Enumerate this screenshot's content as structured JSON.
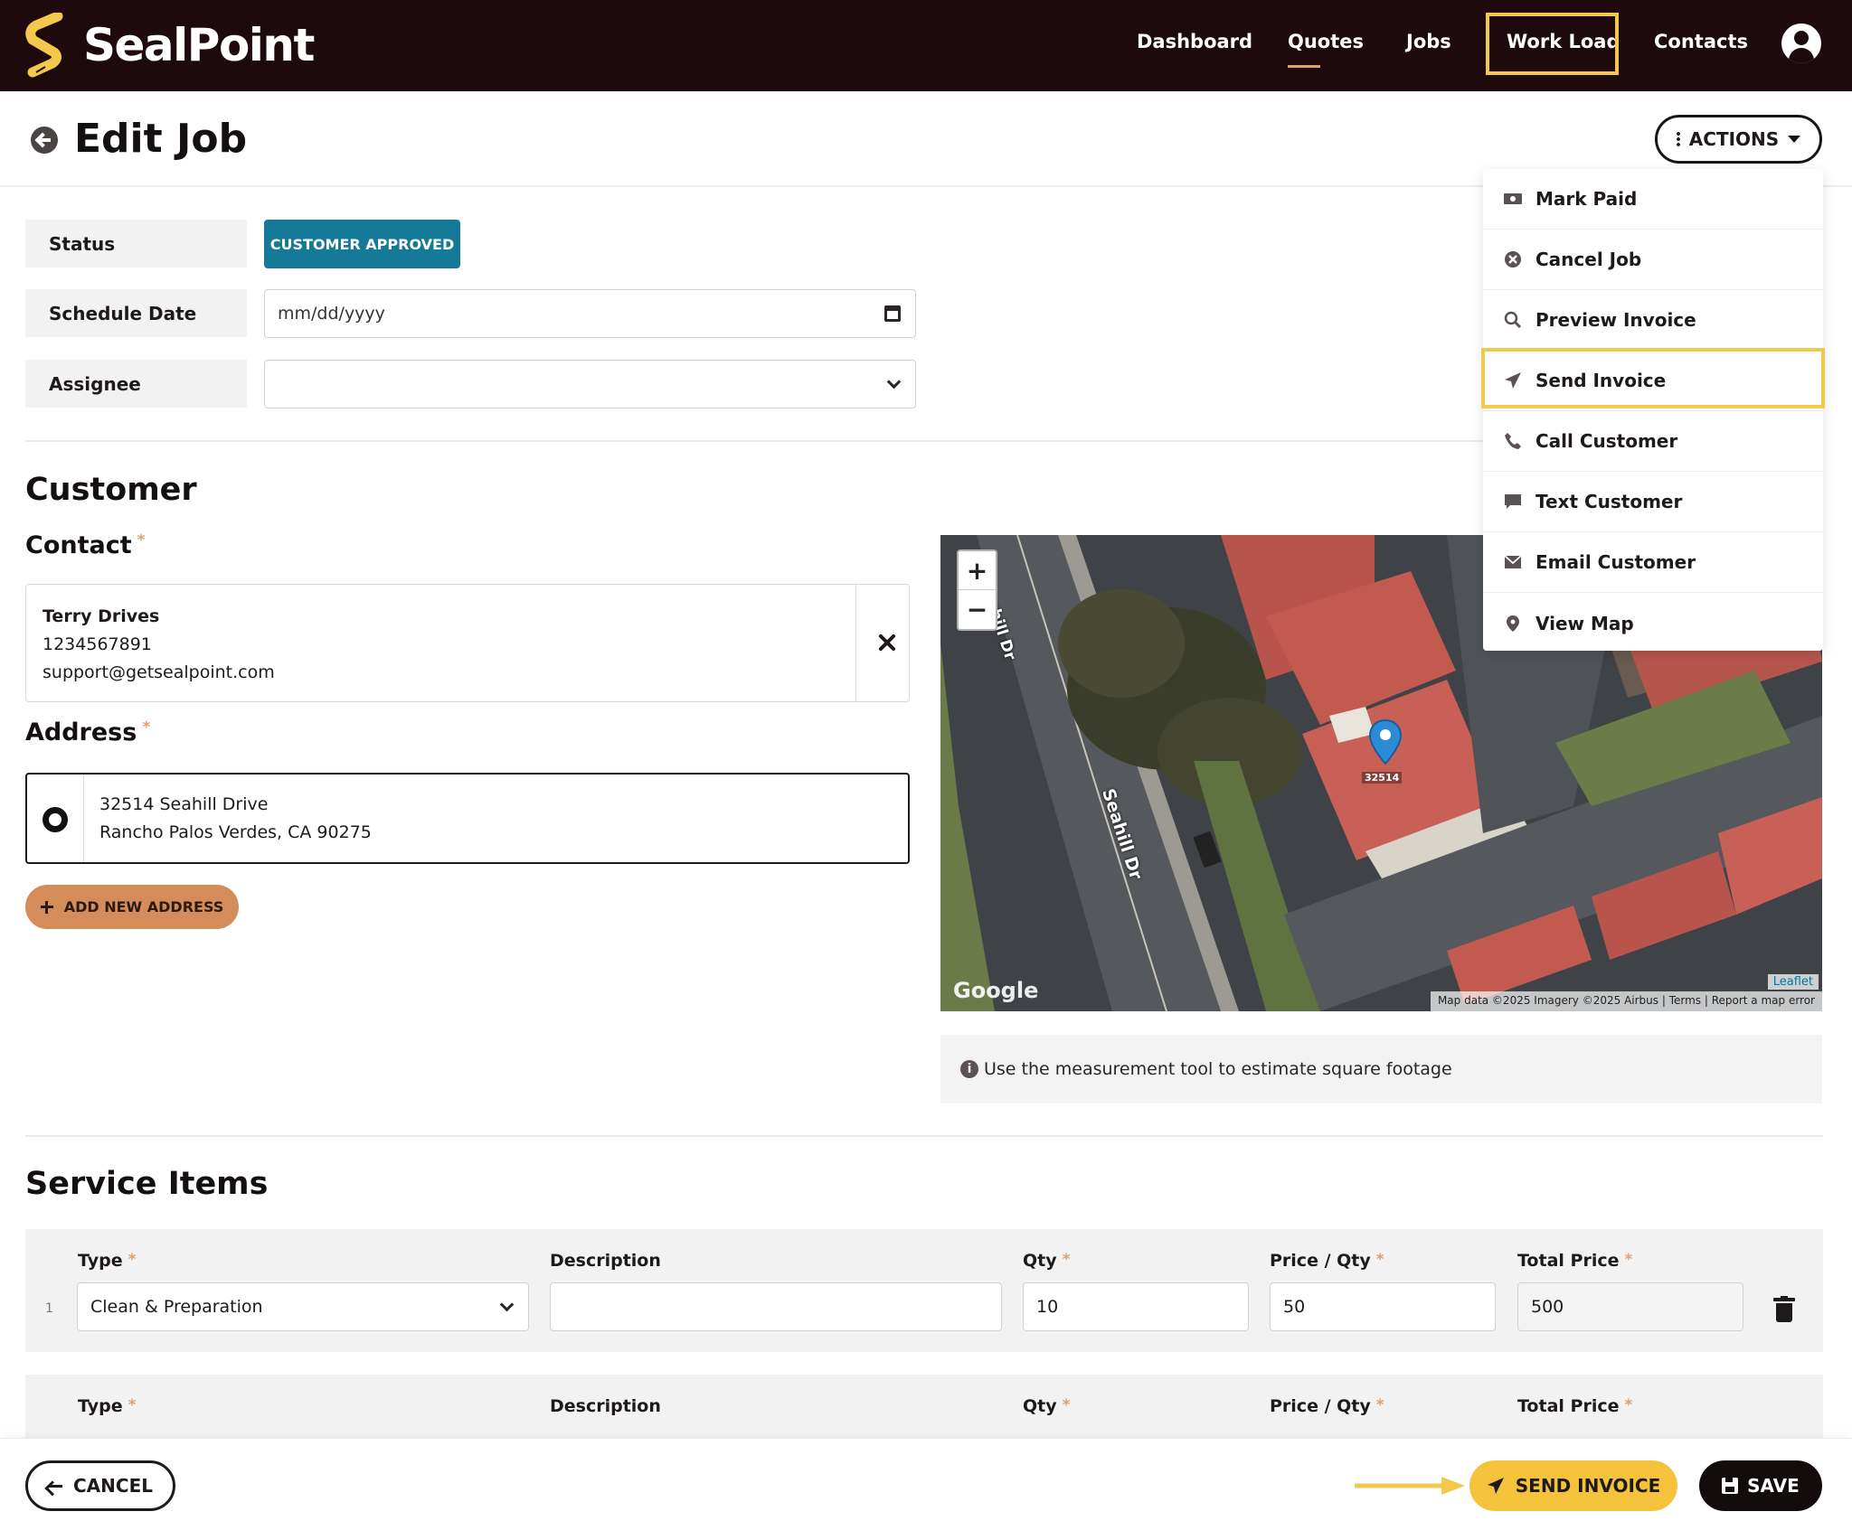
{
  "brand": {
    "name": "SealPoint"
  },
  "nav": {
    "items": [
      {
        "label": "Dashboard"
      },
      {
        "label": "Quotes"
      },
      {
        "label": "Jobs"
      },
      {
        "label": "Work Load"
      },
      {
        "label": "Contacts"
      }
    ],
    "active": "Quotes",
    "highlighted": "Work Load"
  },
  "page": {
    "title": "Edit Job",
    "actions_label": "ACTIONS"
  },
  "actions_menu": {
    "items": [
      {
        "label": "Mark Paid",
        "icon": "cash-icon"
      },
      {
        "label": "Cancel Job",
        "icon": "cancel-circle-icon"
      },
      {
        "label": "Preview Invoice",
        "icon": "search-icon"
      },
      {
        "label": "Send Invoice",
        "icon": "paper-plane-icon"
      },
      {
        "label": "Call Customer",
        "icon": "phone-icon"
      },
      {
        "label": "Text Customer",
        "icon": "chat-bubble-icon"
      },
      {
        "label": "Email Customer",
        "icon": "envelope-icon"
      },
      {
        "label": "View Map",
        "icon": "map-pin-icon"
      }
    ],
    "highlighted": "Send Invoice"
  },
  "form": {
    "status": {
      "label": "Status",
      "value": "CUSTOMER APPROVED",
      "color": "#157a97"
    },
    "schedule_date": {
      "label": "Schedule Date",
      "placeholder": "mm/dd/yyyy"
    },
    "assignee": {
      "label": "Assignee",
      "value": ""
    }
  },
  "customer": {
    "section_title": "Customer",
    "contact_label": "Contact",
    "required_mark": "*",
    "contact": {
      "name": "Terry Drives",
      "phone": "1234567891",
      "email": "support@getsealpoint.com"
    },
    "address_label": "Address",
    "address": {
      "line1": "32514 Seahill Drive",
      "line2": "Rancho Palos Verdes, CA 90275"
    },
    "add_address_label": "ADD NEW ADDRESS"
  },
  "map": {
    "zoom_in": "+",
    "zoom_out": "−",
    "street_1": "Seahill Dr",
    "street_2": "Seahill Dr",
    "pin_label": "32514",
    "google_label": "Google",
    "leaflet_label": "Leaflet",
    "attribution": "Map data ©2025 Imagery ©2025 Airbus | Terms | Report a map error",
    "hint": "Use the measurement tool to estimate square footage"
  },
  "service_items": {
    "section_title": "Service Items",
    "columns": {
      "type": "Type",
      "description": "Description",
      "qty": "Qty",
      "price_qty": "Price / Qty",
      "total_price": "Total Price"
    },
    "rows": [
      {
        "index": "1",
        "type": "Clean & Preparation",
        "description": "",
        "qty": "10",
        "price": "50",
        "total": "500"
      }
    ]
  },
  "footer": {
    "cancel_label": "CANCEL",
    "send_invoice_label": "SEND INVOICE",
    "save_label": "SAVE"
  },
  "colors": {
    "nav_bg": "#1e0a0c",
    "accent_yellow": "#f5c33b",
    "highlight_outline": "#f2c94c",
    "add_address_bg": "#d48d5a",
    "status_teal": "#157a97"
  }
}
